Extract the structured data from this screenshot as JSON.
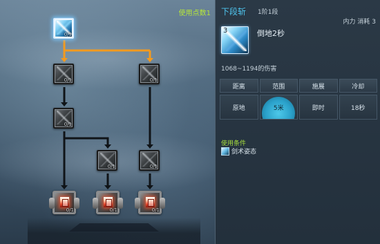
{
  "tree": {
    "points_label": "使用点数1",
    "nodes": [
      {
        "id": "root",
        "count": "0/1",
        "active": true,
        "ultimate": false
      },
      {
        "id": "l1",
        "count": "0/1",
        "active": false,
        "ultimate": false
      },
      {
        "id": "r1",
        "count": "0/1",
        "active": false,
        "ultimate": false
      },
      {
        "id": "l2",
        "count": "0/1",
        "active": false,
        "ultimate": false
      },
      {
        "id": "m3",
        "count": "0/1",
        "active": false,
        "ultimate": false
      },
      {
        "id": "r3",
        "count": "0/1",
        "active": false,
        "ultimate": false
      },
      {
        "id": "u1",
        "count": "0/1",
        "active": false,
        "ultimate": true
      },
      {
        "id": "u2",
        "count": "0/1",
        "active": false,
        "ultimate": true
      },
      {
        "id": "u3",
        "count": "0/1",
        "active": false,
        "ultimate": true
      }
    ],
    "colors": {
      "selected_path": "#f39a1e",
      "path": "#101418"
    }
  },
  "detail": {
    "skill_name": "下段斩",
    "skill_level": "1阶1段",
    "cost": "内力 消耗 3",
    "icon": {
      "rank": "3",
      "name": "sword-slash-icon"
    },
    "effect": "倒地2秒",
    "damage": "1068~1194的伤害",
    "stats": {
      "headers": [
        "距离",
        "范围",
        "施展",
        "冷却"
      ],
      "values": [
        "原地",
        "5米",
        "即时",
        "18秒"
      ]
    },
    "condition": {
      "title": "使用条件",
      "icon": "sword-stance-icon",
      "text": "剑术姿态"
    },
    "colors": {
      "skill_name": "#4fc6f0",
      "condition_title": "#a6dd3e",
      "range_fill": "#2aa6d1"
    }
  }
}
